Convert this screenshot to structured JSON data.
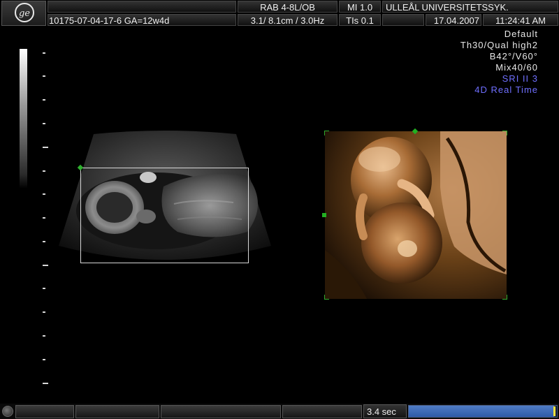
{
  "header": {
    "probe": "RAB 4-8L/OB",
    "mi": "MI  1.0",
    "institution": "ULLEÅL UNIVERSITETSSYK.",
    "patient_id": "10175-07-04-17-6  GA=12w4d",
    "depth": "3.1/ 8.1cm / 3.0Hz",
    "tis": "TIs  0.1",
    "date": "17.04.2007",
    "time": "11:24:41 AM"
  },
  "settings": {
    "lines": [
      {
        "text": "Default",
        "color": "#e8e8e8"
      },
      {
        "text": "Th30/Qual high2",
        "color": "#e8e8e8"
      },
      {
        "text": "B42°/V60°",
        "color": "#e8e8e8"
      },
      {
        "text": "Mix40/60",
        "color": "#e8e8e8"
      },
      {
        "text": "SRI II 3",
        "color": "#6f6fff"
      },
      {
        "text": "4D Real Time",
        "color": "#6f6fff"
      }
    ]
  },
  "icons": {
    "logo": "ge-logo",
    "gray_scale": "grayscale-bar",
    "knob": "trackball-knob"
  },
  "footer": {
    "cine_time": "3.4 sec",
    "cine_progress": 0.98
  },
  "colors": {
    "roi_marker": "#22b022",
    "accent_text": "#6f6fff",
    "progress": "#4f7cc6",
    "cursor": "#ffe23a"
  }
}
